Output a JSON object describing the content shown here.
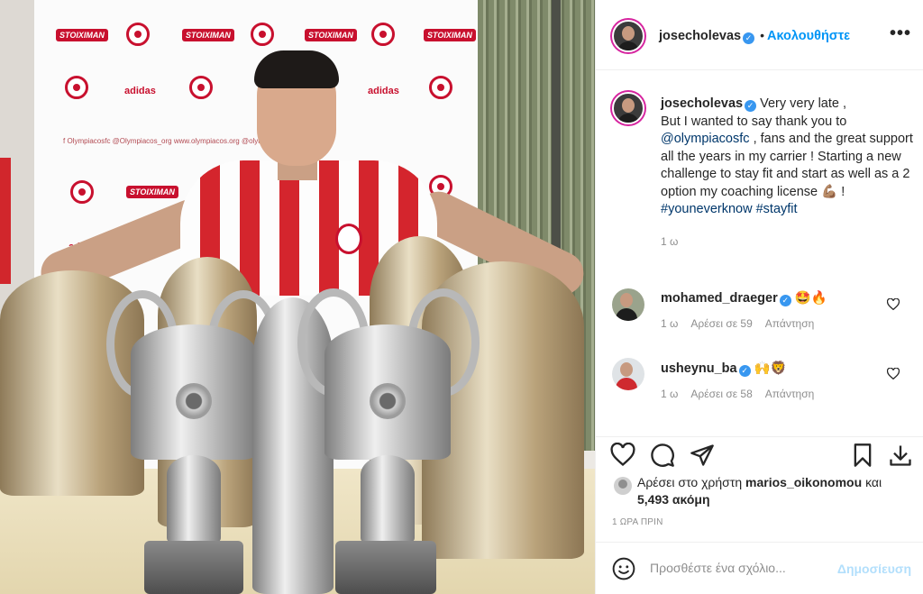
{
  "photo": {
    "wall_brand_1": "STOIXIMAN",
    "wall_brand_2": "adidas",
    "wall_social": "f  Olympiacosfc   @Olympiacos_org   www.olympiacos.org   @olympiacos_org"
  },
  "header": {
    "username": "josecholevas",
    "follow_label": "Ακολουθήστε",
    "more_icon": "more-horizontal-icon"
  },
  "caption": {
    "username": "josecholevas",
    "text_1": "Very very late ,",
    "text_2": "But I wanted to say thank you to",
    "mention": "@olympiacosfc",
    "text_3": ", fans and the great support all the years in my carrier ! Starting a new challenge to stay fit and start as well as a 2 option my coaching license",
    "emoji": "💪🏽",
    "text_4": "!",
    "hashtag_1": "#youneverknow",
    "hashtag_2": "#stayfit",
    "time": "1 ω"
  },
  "comments": [
    {
      "username": "mohamed_draeger",
      "text": "🤩🔥",
      "time": "1 ω",
      "likes": "Αρέσει σε 59",
      "reply": "Απάντηση"
    },
    {
      "username": "usheynu_ba",
      "text": "🙌🦁",
      "time": "1 ω",
      "likes": "Αρέσει σε 58",
      "reply": "Απάντηση"
    }
  ],
  "likes": {
    "prefix": "Αρέσει στο χρήστη",
    "user": "marios_oikonomou",
    "and": "και",
    "count": "5,493 ακόμη"
  },
  "time_ago": "1 ΩΡΑ ΠΡΙΝ",
  "add_comment": {
    "placeholder": "Προσθέστε ένα σχόλιο...",
    "post_label": "Δημοσίευση"
  },
  "colors": {
    "accent": "#0095f6",
    "verified": "#3897f0",
    "muted": "#8e8e8e",
    "post_disabled": "#b2dffc"
  }
}
